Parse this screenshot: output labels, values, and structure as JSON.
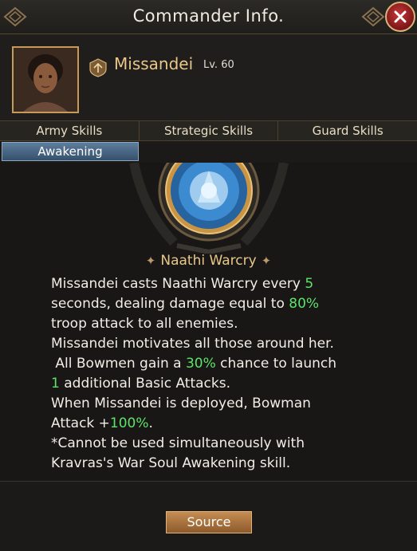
{
  "header": {
    "title": "Commander Info."
  },
  "commander": {
    "name": "Missandei",
    "level": "Lv. 60"
  },
  "tabs": [
    {
      "label": "Army Skills"
    },
    {
      "label": "Strategic Skills"
    },
    {
      "label": "Guard Skills"
    }
  ],
  "subtab": {
    "label": "Awakening",
    "active": true
  },
  "skill": {
    "name": "Naathi Warcry",
    "description": [
      {
        "t": "Missandei casts Naathi Warcry every "
      },
      {
        "t": "5",
        "g": true
      },
      {
        "t": "\nseconds, dealing damage equal to "
      },
      {
        "t": "80%",
        "g": true
      },
      {
        "t": "\ntroop attack to all enemies.\nMissandei motivates all those around her.\n All Bowmen gain a "
      },
      {
        "t": "30%",
        "g": true
      },
      {
        "t": " chance to launch\n"
      },
      {
        "t": "1",
        "g": true
      },
      {
        "t": " additional Basic Attacks.\nWhen Missandei is deployed, Bowman\nAttack +"
      },
      {
        "t": "100%",
        "g": true
      },
      {
        "t": ".\n*Cannot be used simultaneously with\nKravras's War Soul Awakening skill."
      }
    ]
  },
  "footer": {
    "source_label": "Source"
  },
  "colors": {
    "highlight": "#5ee36a",
    "gold": "#e9c789",
    "close": "#b8282c",
    "subtab_active": "#4a6a8a"
  },
  "icons": {
    "close": "close-icon",
    "rank": "rank-badge-icon",
    "ornament": "header-ornament-icon",
    "skill": "skill-emblem-icon"
  }
}
